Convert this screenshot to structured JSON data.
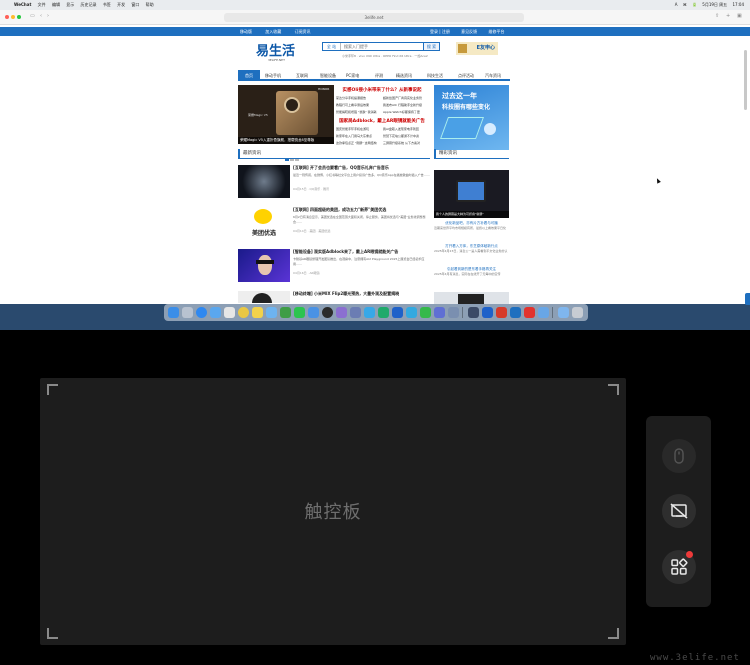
{
  "menubar": {
    "app": "WeChat",
    "items": [
      "文件",
      "编辑",
      "显示",
      "历史记录",
      "书签",
      "开发",
      "窗口",
      "帮助"
    ],
    "status_items": [
      "A",
      "⌘",
      "🔋",
      "5月19日 周五",
      "17:04"
    ]
  },
  "browser": {
    "url": "3elife.net"
  },
  "site": {
    "top_links_left": [
      "移动版",
      "加入收藏",
      "订阅资讯"
    ],
    "top_links_right": [
      "登录 | 注册",
      "意见反馈",
      "维修平台"
    ],
    "logo": "易生活",
    "logo_sub": "3ELIFE.NET",
    "search_select": "全 站",
    "search_placeholder": "搜索入门提手",
    "search_button": "搜 索",
    "hot_words": "小米手环8 · vivo X90 Ultra · OPPO Find X6 Ultra · 一加Ace2",
    "header_ad": "E友申心",
    "nav": [
      "首页",
      "移动手机",
      "互联网",
      "智能设备",
      "PC家电",
      "评测",
      "精选资讯",
      "科技生活",
      "点评活动",
      "汽车资讯"
    ],
    "hero_brand": "HONOR",
    "hero_tag": "荣耀Magic V5",
    "hero_caption": "荣耀Magic V5入重折叠旗舰，搭载骁龙8至尊版",
    "headline_1": "实感Oli接小米带来了什么？从新事说起",
    "headline_2": "国家局Adblock，戴上AR眼镜就能关广告",
    "headline_rows_1": [
      [
        "蒙达分享手机提课报告",
        "超新给国产厂商真实化业务管"
      ],
      [
        "教程行可上看享测后效果",
        "我发布AIC 行程助手全新升级"
      ],
      [
        "智能揭晓和增强 \"暴跌\" 我消耗",
        "Apple Watch好都保持了更"
      ]
    ],
    "headline_rows_2": [
      [
        "国庆智能手环手机在游玩",
        "我AI盘取入发现家电手到回"
      ],
      [
        "新家年在入门用马大东重点",
        "智慧下花块公都通不计中资"
      ],
      [
        "这款承包点正 \"刚屏\" 这两结构",
        "三屏幕升级系统 从下方案对"
      ]
    ],
    "promo_line1": "过去这一年",
    "promo_line2": "科技圈有哪些变化",
    "latest_title": "最新资讯",
    "featured_title": "精彩资讯",
    "articles": [
      {
        "title": "[互联网] 开了会员也要看广告，QQ音乐礼弃广告音乐",
        "summary": "最近一则传闻，在微博，小红书等社交平台上用户投诉广告多，QQ音乐App在播放歌曲时插入广告……",
        "meta": "04月15日 · QQ音乐 · 腾讯"
      },
      {
        "title": "[互联网] 四面超级的美团，成功五力\"新养\"美团优选",
        "summary": "6月2日有消息显示，美团优选在全国范围大面积关闭，停止服务，美团将优选与\"美团\"业务线调整整合……",
        "meta": "04月14日 · 美团 · 美团优选",
        "thumb_text": "美团优选"
      },
      {
        "title": "[智能设备] 观实版Adblock来了，戴上AR眼镜就能关广告",
        "summary": "卡耐基AR眼镜整理开发团队推出，在观察中，注意拥有AI2 Playground 2025上展览会已经初步应用……",
        "meta": "04月16日 · AR眼镜"
      },
      {
        "title": "[移动终端] 小米MIX Flip2曝光预热，大量外观及配置揭晓",
        "summary": "",
        "meta": ""
      }
    ],
    "side_hero_caption": "我个人的屏幕是大种为可折叠\"新屏\"",
    "side_items": [
      {
        "title": "优化新品吧，亦有片方补看与可播",
        "summary": "近期来世界平均市场规模有所，最终以上看效果平日化"
      },
      {
        "title": "打开看入方体，东芝原体破新行点",
        "summary": "2025年4月23日，消息公一是人需看到平文化业务的认"
      },
      {
        "title": "引起看到新的是东看手格再关注",
        "summary": "2025年4月有消息，实际在在线开了无每中的宣传"
      }
    ]
  },
  "touchpad": {
    "label": "触控板"
  },
  "controls": {
    "mouse_icon": "mouse-icon",
    "screen_off_icon": "screen-off-icon",
    "apps_icon": "apps-grid-icon"
  },
  "watermark": "www.3elife.net",
  "colors": {
    "site_blue": "#1e6fbf",
    "headline_red": "#cc0000",
    "badge_red": "#ee3a3a",
    "panel_bg": "#1d1d1d"
  }
}
